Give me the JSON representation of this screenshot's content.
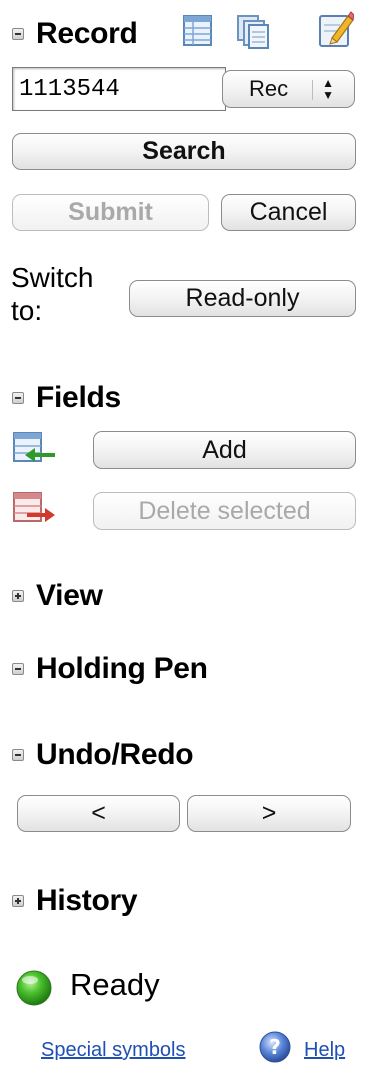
{
  "record": {
    "title": "Record",
    "record_id": "1113544",
    "select_value": "Rec",
    "search_label": "Search",
    "submit_label": "Submit",
    "cancel_label": "Cancel",
    "switch_to_label": "Switch to:",
    "readonly_label": "Read-only"
  },
  "fields": {
    "title": "Fields",
    "add_label": "Add",
    "delete_label": "Delete selected"
  },
  "view": {
    "title": "View"
  },
  "holding_pen": {
    "title": "Holding Pen"
  },
  "undo_redo": {
    "title": "Undo/Redo",
    "undo_label": "<",
    "redo_label": ">"
  },
  "history": {
    "title": "History"
  },
  "status": {
    "text": "Ready",
    "color": "#2e9e1e"
  },
  "footer": {
    "special_symbols": "Special symbols",
    "help": "Help"
  },
  "icons": [
    "table-icon",
    "copy-icon",
    "edit-icon",
    "add-field-icon",
    "delete-field-icon",
    "ready-icon",
    "help-icon"
  ]
}
